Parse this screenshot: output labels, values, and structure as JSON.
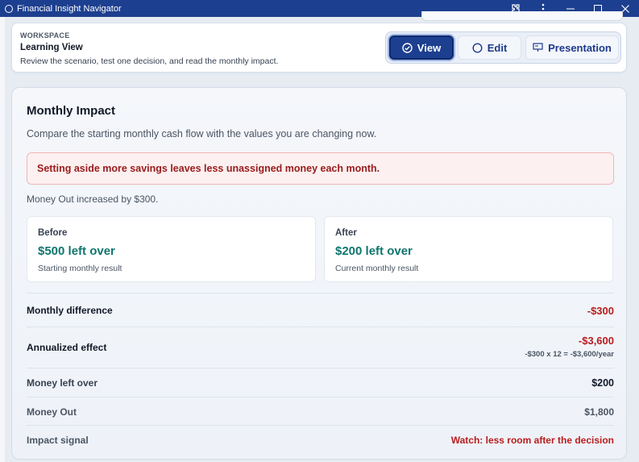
{
  "window": {
    "title": "Financial Insight Navigator",
    "icons": [
      "app-icon",
      "extension-icon",
      "more-icon",
      "minimize-icon",
      "maximize-icon",
      "close-icon"
    ]
  },
  "workspace": {
    "eyebrow": "WORKSPACE",
    "title": "Learning View",
    "description": "Review the scenario, test one decision, and read the monthly impact.",
    "modes": {
      "view": "View",
      "edit": "Edit",
      "presentation": "Presentation",
      "selected": "View"
    }
  },
  "impact": {
    "title": "Monthly Impact",
    "description": "Compare the starting monthly cash flow with the values you are changing now.",
    "alert": "Setting aside more savings leaves less unassigned money each month.",
    "change_note": "Money Out increased by $300.",
    "before": {
      "label": "Before",
      "value": "$500 left over",
      "caption": "Starting monthly result"
    },
    "after": {
      "label": "After",
      "value": "$200 left over",
      "caption": "Current monthly result"
    },
    "rows": {
      "monthly_difference": {
        "label": "Monthly difference",
        "value": "-$300"
      },
      "annualized_effect": {
        "label": "Annualized effect",
        "value": "-$3,600",
        "formula": "-$300 x 12 = -$3,600/year"
      },
      "money_left_over": {
        "label": "Money left over",
        "value": "$200"
      },
      "money_out": {
        "label": "Money Out",
        "value": "$1,800"
      },
      "impact_signal": {
        "label": "Impact signal",
        "value": "Watch: less room after the decision"
      }
    },
    "colors": {
      "negative": "#b91c1c",
      "positive": "#0f766e",
      "accent": "#1d3f8f"
    }
  }
}
